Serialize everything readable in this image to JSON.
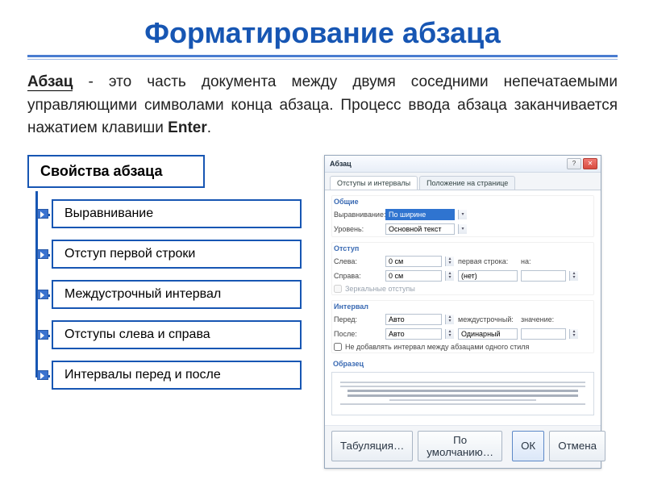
{
  "title": "Форматирование абзаца",
  "definition": {
    "term": "Абзац",
    "text": " - это часть документа между двумя соседними непечатаемыми управляющими символами конца абзаца. Процесс ввода абзаца заканчивается нажатием клавиши ",
    "kbd": "Enter",
    "tail": "."
  },
  "props_root": "Свойства абзаца",
  "props": [
    "Выравнивание",
    "Отступ первой строки",
    "Междустрочный интервал",
    "Отступы слева и справа",
    "Интервалы перед и после"
  ],
  "dialog": {
    "caption": "Абзац",
    "tabs": [
      "Отступы и интервалы",
      "Положение на странице"
    ],
    "group_general": "Общие",
    "align_label": "Выравнивание:",
    "align_value": "По ширине",
    "level_label": "Уровень:",
    "level_value": "Основной текст",
    "group_indent": "Отступ",
    "left_label": "Слева:",
    "left_value": "0 см",
    "right_label": "Справа:",
    "right_value": "0 см",
    "first_label": "первая строка:",
    "first_value": "(нет)",
    "on_label": "на:",
    "mirror_label": "Зеркальные отступы",
    "group_spacing": "Интервал",
    "before_label": "Перед:",
    "before_value": "Авто",
    "after_label": "После:",
    "after_value": "Авто",
    "linesp_label": "междустрочный:",
    "linesp_value": "Одинарный",
    "val_label": "значение:",
    "nosame_label": "Не добавлять интервал между абзацами одного стиля",
    "sample_label": "Образец",
    "btn_tabs": "Табуляция…",
    "btn_default": "По умолчанию…",
    "btn_ok": "ОК",
    "btn_cancel": "Отмена"
  }
}
